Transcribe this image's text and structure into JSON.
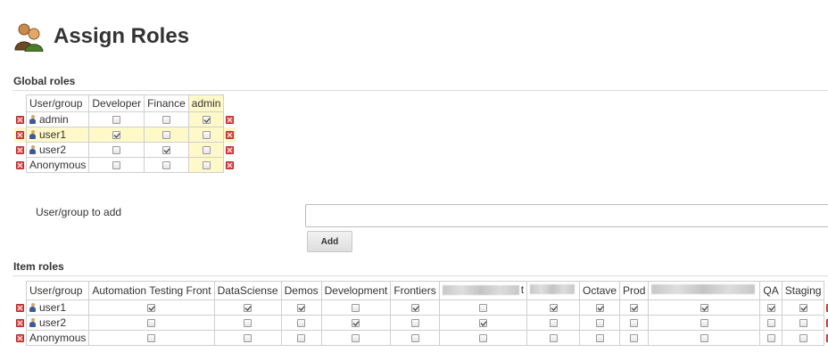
{
  "header": {
    "title": "Assign Roles",
    "icon": "people-icon"
  },
  "global_roles": {
    "heading": "Global roles",
    "columns": [
      "User/group",
      "Developer",
      "Finance",
      "admin"
    ],
    "rows": [
      {
        "name": "admin",
        "user_icon": true,
        "checks": [
          false,
          false,
          true
        ]
      },
      {
        "name": "user1",
        "user_icon": true,
        "checks": [
          true,
          false,
          false
        ]
      },
      {
        "name": "user2",
        "user_icon": true,
        "checks": [
          false,
          true,
          false
        ]
      },
      {
        "name": "Anonymous",
        "user_icon": false,
        "checks": [
          false,
          false,
          false
        ]
      }
    ]
  },
  "add_user": {
    "label": "User/group to add",
    "value": "",
    "placeholder": "",
    "button_label": "Add"
  },
  "item_roles": {
    "heading": "Item roles",
    "columns": [
      "User/group",
      "Automation Testing Front",
      "DataSciense",
      "Demos",
      "Development",
      "Frontiers",
      "t",
      "",
      "Octave",
      "Prod",
      "",
      "QA",
      "Staging"
    ],
    "rows": [
      {
        "name": "user1",
        "user_icon": true,
        "checks": [
          true,
          true,
          true,
          false,
          true,
          false,
          true,
          true,
          true,
          true,
          true,
          true
        ]
      },
      {
        "name": "user2",
        "user_icon": true,
        "checks": [
          false,
          false,
          false,
          true,
          false,
          true,
          false,
          false,
          false,
          false,
          false,
          false
        ]
      },
      {
        "name": "Anonymous",
        "user_icon": false,
        "checks": [
          false,
          false,
          false,
          false,
          false,
          false,
          false,
          false,
          false,
          false,
          false,
          false
        ]
      }
    ]
  }
}
